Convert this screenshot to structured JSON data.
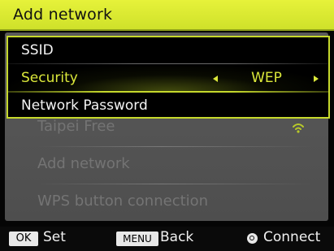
{
  "title": "Add network",
  "colors": {
    "accent": "#c6d92c",
    "title_bg": "#dce834",
    "selected_text": "#dbe83a"
  },
  "background_list": {
    "items": [
      {
        "label": "Taipei Free",
        "icon": "wifi-signal-icon"
      },
      {
        "label": "Add network"
      },
      {
        "label": "WPS button connection"
      }
    ]
  },
  "form": {
    "ssid_label": "SSID",
    "security_label": "Security",
    "security_value": "WEP",
    "password_label": "Network Password"
  },
  "footer": {
    "ok_key": "OK",
    "ok_label": "Set",
    "menu_key": "MENU",
    "menu_label": "Back",
    "connect_icon": "q-button-icon",
    "connect_label": "Connect"
  }
}
